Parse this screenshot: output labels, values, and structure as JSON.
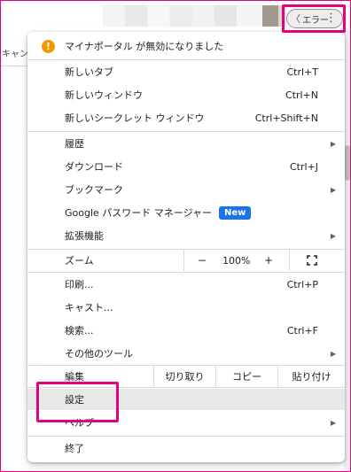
{
  "toolbar": {
    "error_label": "エラー",
    "kebab_glyph": "⋮",
    "left_bracket": "〈"
  },
  "background": {
    "tab_text": "キャンセ"
  },
  "menu": {
    "notice": "マイナポータル が無効になりました",
    "items": [
      {
        "label": "新しいタブ",
        "shortcut": "Ctrl+T"
      },
      {
        "label": "新しいウィンドウ",
        "shortcut": "Ctrl+N"
      },
      {
        "label": "新しいシークレット ウィンドウ",
        "shortcut": "Ctrl+Shift+N"
      },
      {
        "label": "履歴",
        "shortcut": ""
      },
      {
        "label": "ダウンロード",
        "shortcut": "Ctrl+J"
      },
      {
        "label": "ブックマーク",
        "shortcut": ""
      },
      {
        "label": "Google パスワード マネージャー",
        "badge": "New"
      },
      {
        "label": "拡張機能",
        "shortcut": ""
      },
      {
        "label": "印刷...",
        "shortcut": "Ctrl+P"
      },
      {
        "label": "キャスト...",
        "shortcut": ""
      },
      {
        "label": "検索...",
        "shortcut": "Ctrl+F"
      },
      {
        "label": "その他のツール",
        "shortcut": ""
      }
    ],
    "zoom": {
      "label": "ズーム",
      "minus": "−",
      "level": "100%",
      "plus": "+"
    },
    "edit": {
      "label": "編集",
      "cut": "切り取り",
      "copy": "コピー",
      "paste": "貼り付け"
    },
    "settings": "設定",
    "help": "ヘルプ",
    "exit": "終了"
  },
  "colors": {
    "highlight": "#e5007f",
    "new_badge": "#1a73e8",
    "warning": "#f29900"
  },
  "icons": [
    "warning-icon",
    "submenu-arrow-icon",
    "fullscreen-icon",
    "kebab-menu-icon"
  ]
}
